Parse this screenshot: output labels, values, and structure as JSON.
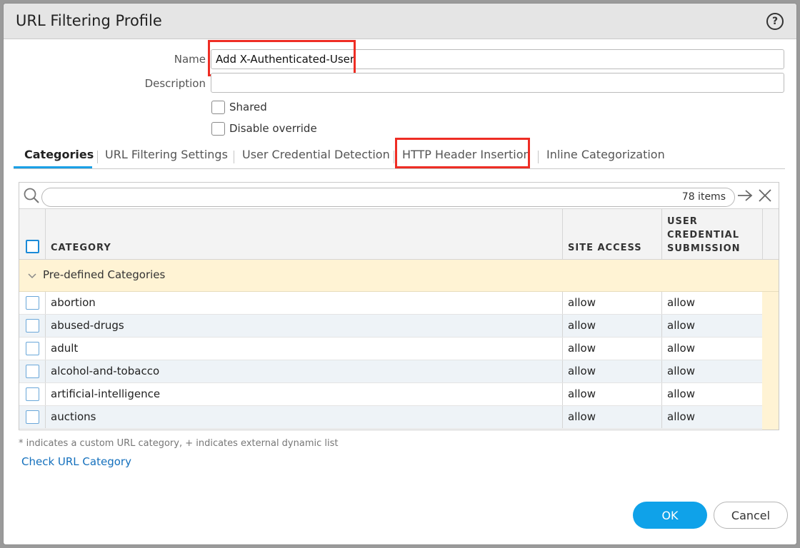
{
  "dialog": {
    "title": "URL Filtering Profile",
    "help_icon": "help-circle-icon",
    "help_glyph": "?"
  },
  "form": {
    "name_label": "Name",
    "name_value": "Add X-Authenticated-User",
    "description_label": "Description",
    "description_value": "",
    "shared_label": "Shared",
    "disable_override_label": "Disable override"
  },
  "tabs": [
    {
      "label": "Categories",
      "active": true
    },
    {
      "label": "URL Filtering Settings",
      "active": false
    },
    {
      "label": "User Credential Detection",
      "active": false
    },
    {
      "label": "HTTP Header Insertion",
      "active": false
    },
    {
      "label": "Inline Categorization",
      "active": false
    }
  ],
  "table": {
    "item_count": "78 items",
    "columns": [
      "CATEGORY",
      "SITE ACCESS",
      "USER",
      "CREDENTIAL",
      "SUBMISSION"
    ],
    "group_label": "Pre-defined Categories",
    "rows": [
      {
        "category": "abortion",
        "site_access": "allow",
        "user_credential": "allow"
      },
      {
        "category": "abused-drugs",
        "site_access": "allow",
        "user_credential": "allow"
      },
      {
        "category": "adult",
        "site_access": "allow",
        "user_credential": "allow"
      },
      {
        "category": "alcohol-and-tobacco",
        "site_access": "allow",
        "user_credential": "allow"
      },
      {
        "category": "artificial-intelligence",
        "site_access": "allow",
        "user_credential": "allow"
      },
      {
        "category": "auctions",
        "site_access": "allow",
        "user_credential": "allow"
      }
    ]
  },
  "footer": {
    "footnote": "* indicates a custom URL category, + indicates external dynamic list",
    "check_link": "Check URL Category",
    "ok_label": "OK",
    "cancel_label": "Cancel"
  },
  "colors": {
    "accent": "#0fa2e9",
    "highlight": "#ee2d24",
    "group_row": "#fff3d4",
    "link": "#1470bd"
  }
}
